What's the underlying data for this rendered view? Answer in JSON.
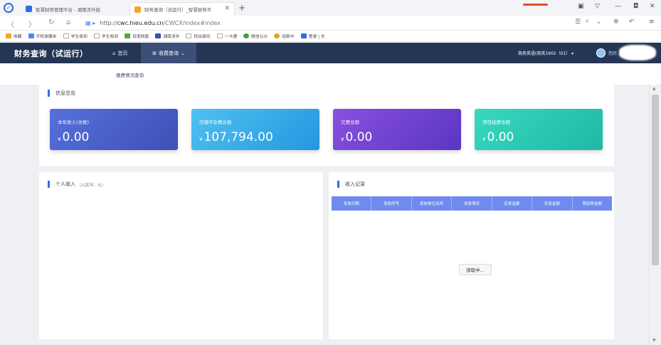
{
  "browser": {
    "tabs": [
      {
        "title": "智慧财务管理平台 - 湖南涉外经",
        "favicon_color": "#2e6be6",
        "active": false
      },
      {
        "title": "财务查询（试运行）_智慧财务平",
        "favicon_color": "#f5a623",
        "active": true
      }
    ],
    "url_prefix": "http://",
    "url_domain": "cwc.hieu.edu.cn",
    "url_path": "/CWCX/index#index",
    "bookmarks": [
      {
        "label": "收藏",
        "icon_color": "#f5a623"
      },
      {
        "label": "手机收藏夹",
        "icon_color": "#4a8af4"
      },
      {
        "label": "学生收到",
        "icon_color": "#aaaaaa"
      },
      {
        "label": "学生收到",
        "icon_color": "#aaaaaa"
      },
      {
        "label": "百度网盘",
        "icon_color": "#58a83a"
      },
      {
        "label": "湖南涉外",
        "icon_color": "#3355aa"
      },
      {
        "label": "找出湖北",
        "icon_color": "#aaaaaa"
      },
      {
        "label": "一卡通",
        "icon_color": "#aaaaaa"
      },
      {
        "label": "微信公众",
        "icon_color": "#33aa33"
      },
      {
        "label": "迎新中",
        "icon_color": "#e8a020"
      },
      {
        "label": "登录 | 东",
        "icon_color": "#2e6be6"
      }
    ]
  },
  "app": {
    "title": "财务查询（试运行）",
    "nav_home": "首页",
    "nav_fee": "收费查询",
    "sub_nav": "缴费情况查询",
    "user_info": "商务英语(商英1902（01）",
    "greeting": "您好,"
  },
  "info_panel": {
    "title": "信息总览",
    "cards": [
      {
        "label": "本年收入(含税)",
        "currency": "¥",
        "value": "0.00"
      },
      {
        "label": "应缴学杂费总额",
        "currency": "¥",
        "value": "107,794.00"
      },
      {
        "label": "欠费总额",
        "currency": "¥",
        "value": "0.00"
      },
      {
        "label": "项目经费余额",
        "currency": "¥",
        "value": "0.00"
      }
    ]
  },
  "income_panel": {
    "title": "个人收入",
    "unit": "（人民币：元）"
  },
  "records_panel": {
    "title": "收入记录",
    "columns": [
      "发放日期",
      "发放序号",
      "发放单位名称",
      "发放项目",
      "应发金额",
      "实发金额",
      "预扣税金额"
    ],
    "loading_text": "读取中..."
  },
  "colors": {
    "header_bg": "#253654",
    "accent": "#2f6fde",
    "table_header": "#6f8bef"
  }
}
